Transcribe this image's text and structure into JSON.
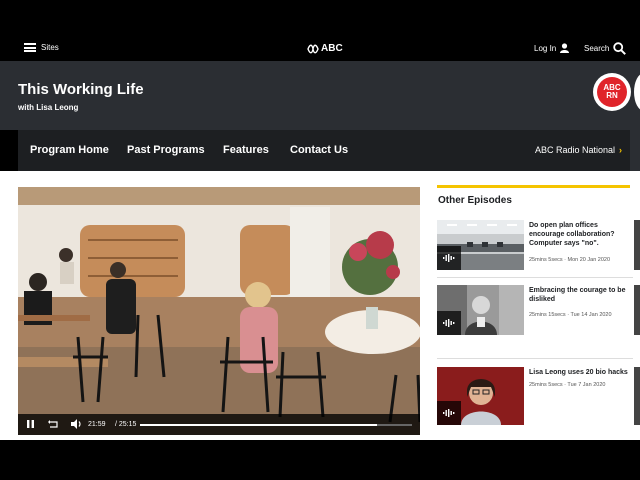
{
  "topbar": {
    "sites_label": "Sites",
    "logo_text": "ABC",
    "login_label": "Log In",
    "search_label": "Search"
  },
  "program": {
    "title": "This Working Life",
    "subtitle": "with Lisa Leong",
    "badge_line1": "ABC",
    "badge_line2": "RN"
  },
  "nav": {
    "items": [
      "Program Home",
      "Past Programs",
      "Features",
      "Contact Us"
    ],
    "network_link": "ABC Radio National",
    "network_chevron": "›"
  },
  "player": {
    "current_time": "21:59",
    "duration": "/ 25:15",
    "progress": 0.87
  },
  "sidebar": {
    "heading": "Other Episodes",
    "episodes": [
      {
        "title": "Do open plan offices encourage collaboration? Computer says \"no\".",
        "meta": "25mins 5secs · Mon 20 Jan 2020"
      },
      {
        "title": "Embracing the courage to be disliked",
        "meta": "25mins 15secs · Tue 14 Jan 2020"
      },
      {
        "title": "Lisa Leong uses 20 bio hacks",
        "meta": "25mins 5secs · Tue 7 Jan 2020"
      }
    ]
  },
  "colors": {
    "accent_yellow": "#f5c400",
    "header_bg": "#2b2e33",
    "nav_bg": "#1d1f22",
    "rn_red": "#e0242a"
  }
}
